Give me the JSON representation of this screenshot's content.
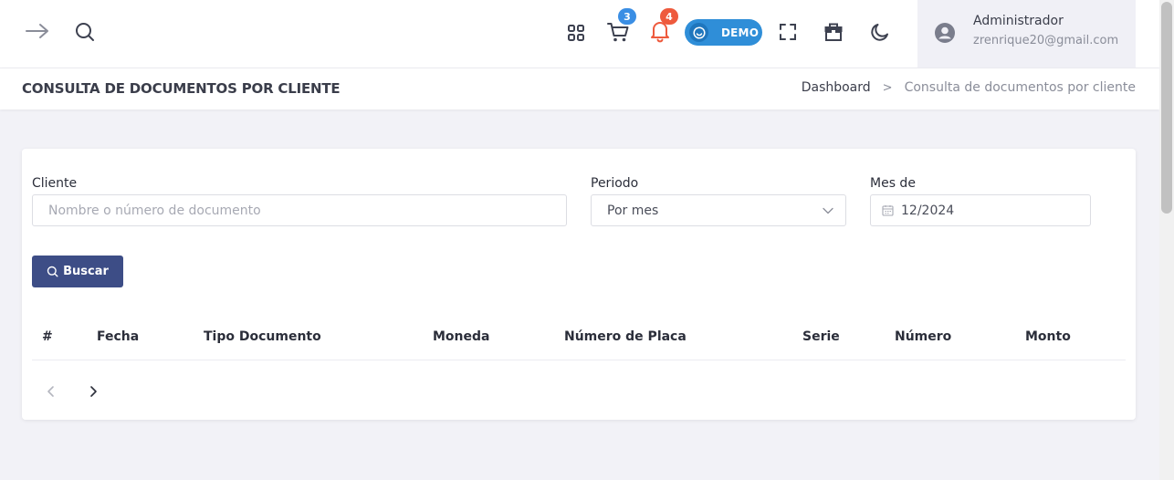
{
  "header": {
    "cart_count": "3",
    "notifications_count": "4",
    "demo_label": "DEMO",
    "user": {
      "name": "Administrador",
      "email": "zrenrique20@gmail.com"
    }
  },
  "page": {
    "title": "CONSULTA DE DOCUMENTOS POR CLIENTE",
    "breadcrumb": {
      "home": "Dashboard",
      "separator": ">",
      "current": "Consulta de documentos por cliente"
    }
  },
  "filters": {
    "cliente": {
      "label": "Cliente",
      "value": "",
      "placeholder": "Nombre o número de documento"
    },
    "periodo": {
      "label": "Periodo",
      "value": "Por mes"
    },
    "mes": {
      "label": "Mes de",
      "value": "12/2024"
    },
    "search_button": "Buscar"
  },
  "table": {
    "columns": [
      "#",
      "Fecha",
      "Tipo Documento",
      "Moneda",
      "Número de Placa",
      "Serie",
      "Número",
      "Monto"
    ],
    "rows": []
  },
  "colors": {
    "primary_button": "#3d4d86",
    "cart_badge": "#3a8ee4",
    "notification_badge": "#ee5a3d",
    "demo_toggle": "#2f8ed8"
  }
}
